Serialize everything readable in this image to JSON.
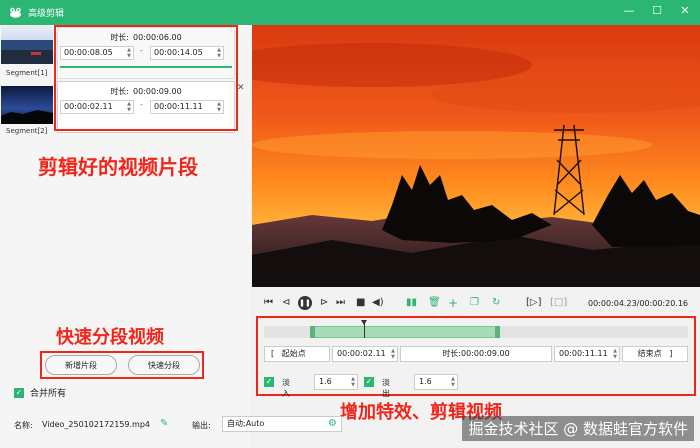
{
  "window": {
    "title": "高级剪辑",
    "minimize": "—",
    "maximize": "☐",
    "close": "✕"
  },
  "segments": [
    {
      "label": "Segment[1]",
      "duration_label": "时长:",
      "duration": "00:00:06.00",
      "start": "00:00:08.05",
      "end": "00:00:14.05",
      "progress": 1.0
    },
    {
      "label": "Segment[2]",
      "duration_label": "时长:",
      "duration": "00:00:09.00",
      "start": "00:00:02.11",
      "end": "00:00:11.11",
      "progress": 0.0
    }
  ],
  "annotations": {
    "segments_note": "剪辑好的视频片段",
    "split_note": "快速分段视频",
    "effects_note": "增加特效、剪辑视频"
  },
  "buttons": {
    "add_segment": "新增片段",
    "quick_split": "快速分段"
  },
  "merge_all": {
    "label": "合并所有",
    "checked": true
  },
  "player": {
    "timecode": "00:00:04.23/00:00:20.16"
  },
  "editor": {
    "start_label": "起始点",
    "start_value": "00:00:02.11",
    "duration_label": "时长:",
    "duration_value": "00:00:09.00",
    "end_value": "00:00:11.11",
    "end_label": "结束点",
    "fade_in_label": "淡入",
    "fade_in_value": "1.6",
    "fade_out_label": "淡出",
    "fade_out_value": "1.6"
  },
  "footer": {
    "name_label": "名称:",
    "name_value": "Video_250102172159.mp4",
    "output_label": "输出:",
    "output_value": "自动;Auto"
  },
  "watermark": "掘金技术社区 @ 数据蛙官方软件",
  "colors": {
    "accent": "#2bb673",
    "annotation_red": "#f0261b"
  }
}
